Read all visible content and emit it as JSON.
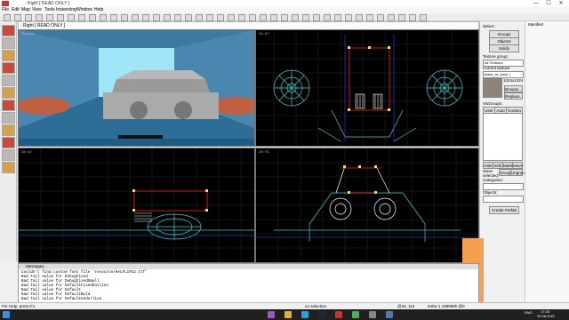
{
  "window": {
    "app_icon": "hammer-app-icon",
    "title": "- Right [ READ ONLY ]",
    "controls": [
      "—",
      "☐",
      "✕"
    ]
  },
  "menu": [
    "File",
    "Edit",
    "Map",
    "View",
    "Tools",
    "Instancing",
    "Window",
    "Help"
  ],
  "document_tab": "- Right [ READ ONLY ]",
  "viewports": {
    "perspective": {
      "label": "Textures"
    },
    "top": {
      "label": "2d: XY"
    },
    "front": {
      "label": "2d: XZ"
    },
    "side": {
      "label": "2d: YZ"
    }
  },
  "right_panel": {
    "select_label": "Select:",
    "groups_btn": "Groups",
    "objects_btn": "Objects",
    "solids_btn": "Solids",
    "texture_group_label": "Texture group:",
    "texture_group_value": "All Textures",
    "current_texture_label": "Current texture:",
    "current_texture_value": "black_hc_back | hedge_f",
    "texture_size": "1024x1024",
    "browse_btn": "Browse...",
    "replace_btn": "Replace...",
    "visgroups_label": "VisGroups:",
    "tab_user": "User",
    "tab_auto": "Auto",
    "tab_cordon": "Cordon",
    "move_selected_label": "Move selected:",
    "categories_label": "Categories:",
    "objects_label": "Objects:",
    "create_prefab_btn": "Create Prefab",
    "group_btn": "Group",
    "ungroup_btn": "Ungroup",
    "hide_btn": "Hide",
    "edit_btn": "Edit",
    "mark_btn": "Mark",
    "move_btn": "Move"
  },
  "far_panel": {
    "label": "Manifest"
  },
  "messages": {
    "title": "Messages",
    "lines": [
      "Couldn't find custom font file 'resource/HALFLIFE2.ttf'",
      "Bad Tail value for DebugFixed",
      "Bad Tail value for DebugFixedSmall",
      "Bad Tail value for DefaultFixedOutline",
      "Bad Tail value for Default",
      "Bad Tail value for DefaultBold",
      "Bad Tail value for DefaultUnderline"
    ]
  },
  "status": {
    "help": "For Help, press F1",
    "selection": "no selection.",
    "coords": "@24, 112",
    "zoom": "640w 1 199999h @0"
  },
  "taskbar": {
    "time": "17:28",
    "date": "20.08.2021",
    "lang": "ENG",
    "icons": [
      "windows-start-icon",
      "search-icon",
      "task-view-icon",
      "file-explorer-icon",
      "edge-browser-icon",
      "steam-icon",
      "hammer-editor-icon",
      "chrome-icon",
      "settings-icon",
      "store-icon"
    ]
  },
  "colors": {
    "wire": "#3fd0c8",
    "selected": "#ff2020",
    "vertex": "#ffe040",
    "grid": "#2a2a2a",
    "orange": "#f5a050"
  }
}
